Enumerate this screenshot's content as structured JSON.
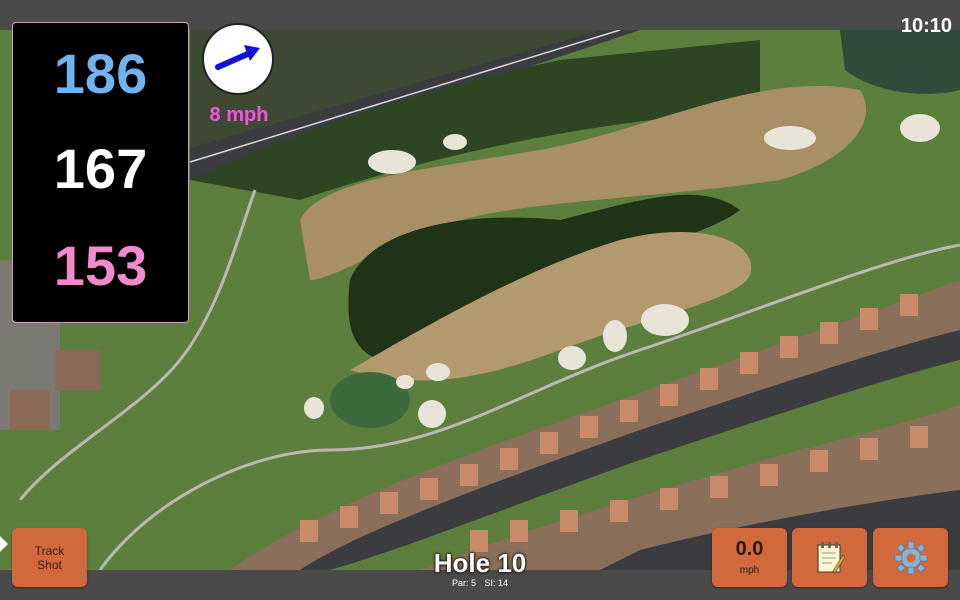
{
  "status": {
    "clock": "10:10"
  },
  "distances": {
    "back": "186",
    "middle": "167",
    "front": "153"
  },
  "wind": {
    "speed": "8 mph",
    "direction_icon": "arrow-right-icon"
  },
  "buttons": {
    "track_shot_line1": "Track",
    "track_shot_line2": "Shot",
    "speed_value": "0.0",
    "speed_unit": "mph",
    "notes_icon": "notepad-icon",
    "settings_icon": "gear-icon"
  },
  "hole": {
    "title": "Hole 10",
    "par": "Par: 5",
    "si": "SI: 14"
  },
  "colors": {
    "back_distance": "#6fb3ef",
    "middle_distance": "#ffffff",
    "front_distance": "#f08acb",
    "wind_text": "#ff4fe6",
    "button": "#d2693d",
    "fairway": "#5a7f3c"
  }
}
